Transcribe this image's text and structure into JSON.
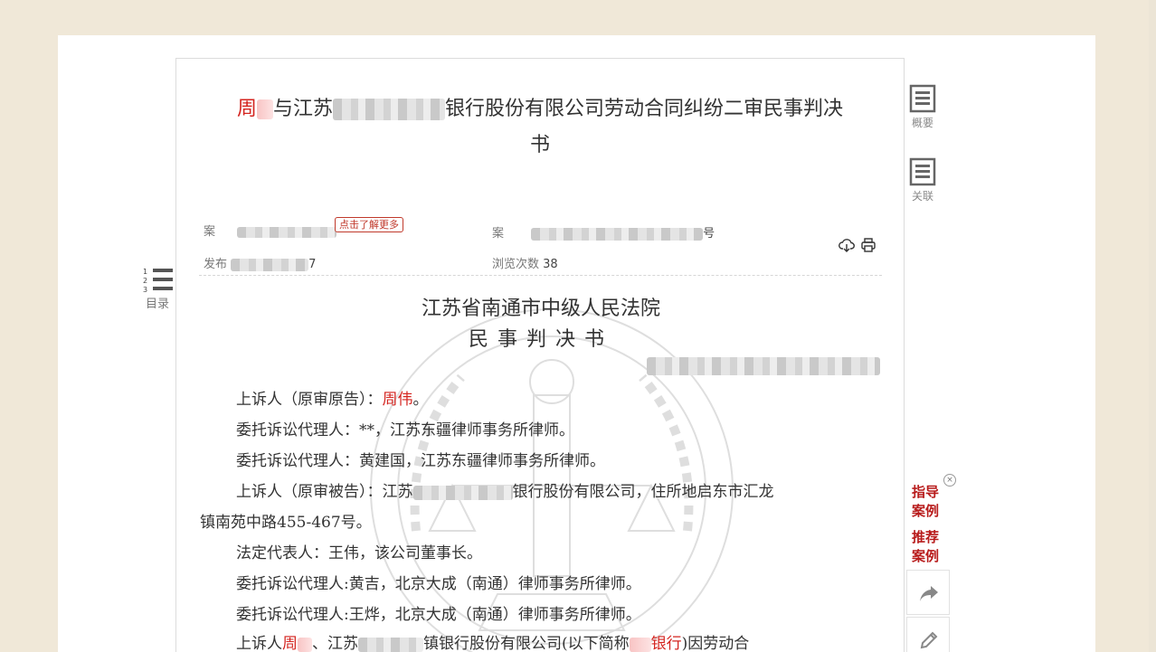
{
  "document": {
    "title_name_red": "周",
    "title_part_1": "与江苏",
    "title_part_2": "银行股份有限公司劳动合同纠纷二审民事判决",
    "title_line_2": "书",
    "meta": {
      "cause_label": "案",
      "learn_more": "点击了解更多",
      "case_label": "案",
      "case_tail": "号",
      "publish_label": "发布",
      "publish_tail": "7",
      "views_label": "浏览次数",
      "views_count": "38"
    },
    "court_name": "江苏省南通市中级人民法院",
    "doc_type": "民事判决书",
    "body_lines": [
      {
        "pre": "上诉人（原审原告）：",
        "red": "周伟",
        "post": "。"
      },
      {
        "pre": "委托诉讼代理人：**，江苏东疆律师事务所律师。"
      },
      {
        "pre": "委托诉讼代理人：黄建国，江苏东疆律师事务所律师。"
      },
      {
        "pre": "上诉人（原审被告）：江苏",
        "post": "银行股份有限公司，住所地启东市汇龙"
      },
      {
        "pre": "镇南苑中路455-467号。"
      },
      {
        "pre": "法定代表人：王伟，该公司董事长。"
      },
      {
        "pre": "委托诉讼代理人:黄吉，北京大成（南通）律师事务所律师。"
      },
      {
        "pre": "委托诉讼代理人:王烨，北京大成（南通）律师事务所律师。"
      },
      {
        "pre": "上诉人",
        "red": "周",
        "mid": "、江苏",
        "post": "镇银行股份有限公司(以下简称",
        "red2": "银行",
        "post2": ")因劳动合"
      }
    ]
  },
  "sidebar": {
    "summary_label": "概要",
    "related_label": "关联",
    "toc_label": "目录",
    "toc_numbers": [
      "1",
      "2",
      "3"
    ],
    "guide_cases": "指导案例",
    "recommended_cases": "推荐案例"
  },
  "colors": {
    "accent_red": "#d4241f",
    "guide_red": "#b81c1c",
    "background": "#f0e8d8"
  }
}
